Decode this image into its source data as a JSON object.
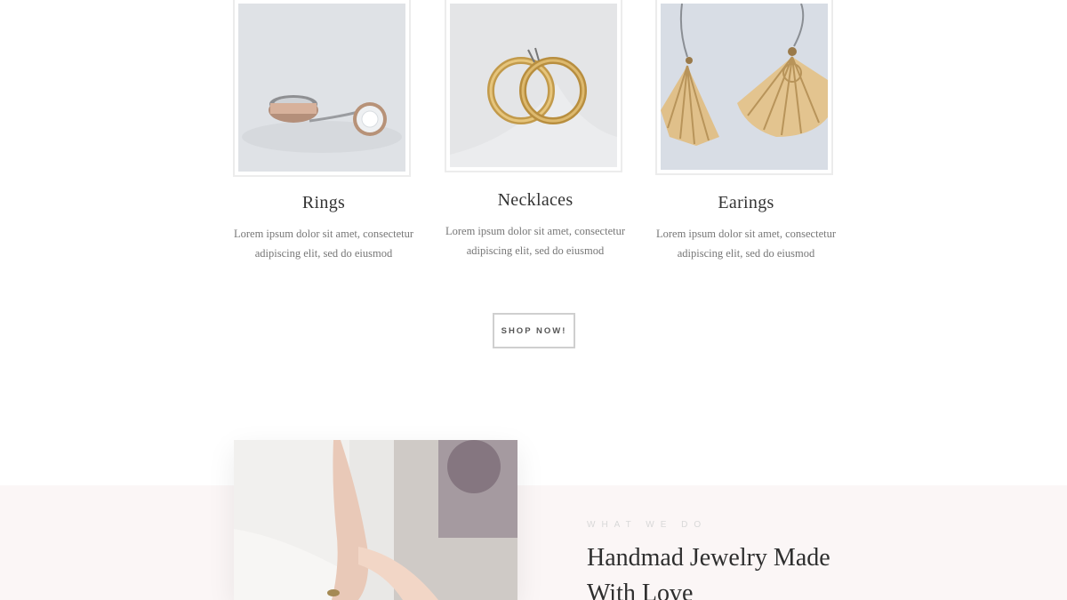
{
  "categories": [
    {
      "title": "Rings",
      "description": "Lorem ipsum dolor sit amet, consectetur adipiscing elit, sed do eiusmod",
      "image_icon": "ring-photo"
    },
    {
      "title": "Necklaces",
      "description": "Lorem ipsum dolor sit amet, consectetur adipiscing elit, sed do eiusmod",
      "image_icon": "hoop-earrings-photo"
    },
    {
      "title": "Earings",
      "description": "Lorem ipsum dolor sit amet, consectetur adipiscing elit, sed do eiusmod",
      "image_icon": "fan-earrings-photo"
    }
  ],
  "shop": {
    "button_label": "SHOP NOW!"
  },
  "about": {
    "eyebrow": "WHAT WE DO",
    "headline": "Handmad Jewelry Made With Love",
    "image_icon": "model-wearing-bracelet-photo"
  },
  "colors": {
    "background": "#ffffff",
    "band": "#fbf6f6",
    "frame_border": "#ececec",
    "text_dark": "#333333",
    "text_muted": "#777777",
    "gold": "#c9a55c"
  }
}
